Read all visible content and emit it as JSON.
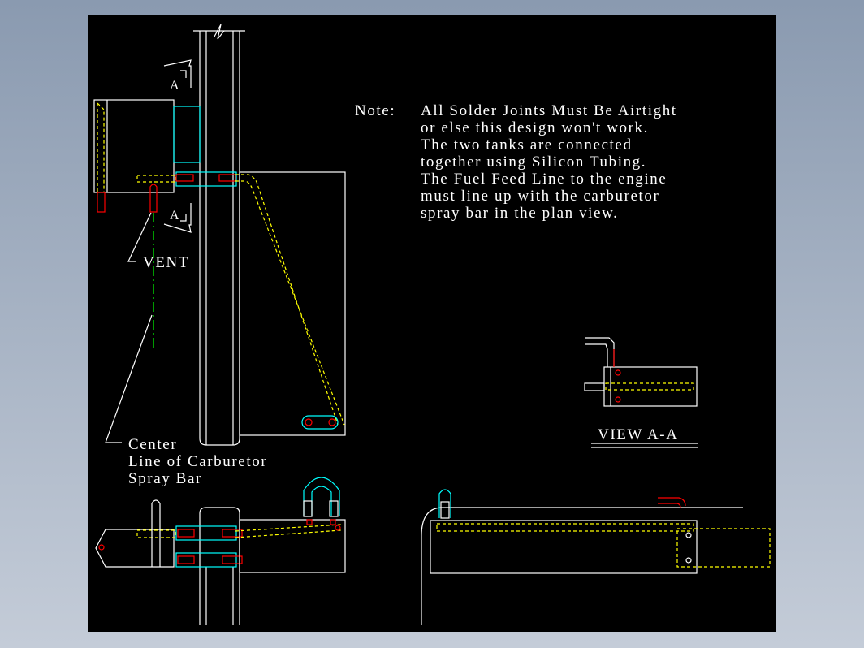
{
  "drawing": {
    "note_label": "Note:",
    "note_lines": [
      "All Solder Joints Must Be Airtight",
      "or else this design won't work.",
      "The two tanks are connected",
      "together using Silicon Tubing.",
      "The Fuel Feed Line to the engine",
      "must line up with the carburetor",
      "spray bar in the plan view."
    ],
    "section_mark_top": "A",
    "section_mark_bottom": "A",
    "vent_label": "VENT",
    "centerline_label": [
      "Center",
      "Line of Carburetor",
      "Spray Bar"
    ],
    "view_label": "VIEW A-A",
    "colors": {
      "background": "#000000",
      "outline": "#ffffff",
      "hidden": "#ffff00",
      "tubing": "#ff0000",
      "fitting": "#00ffff",
      "centerline": "#00ff00"
    }
  }
}
